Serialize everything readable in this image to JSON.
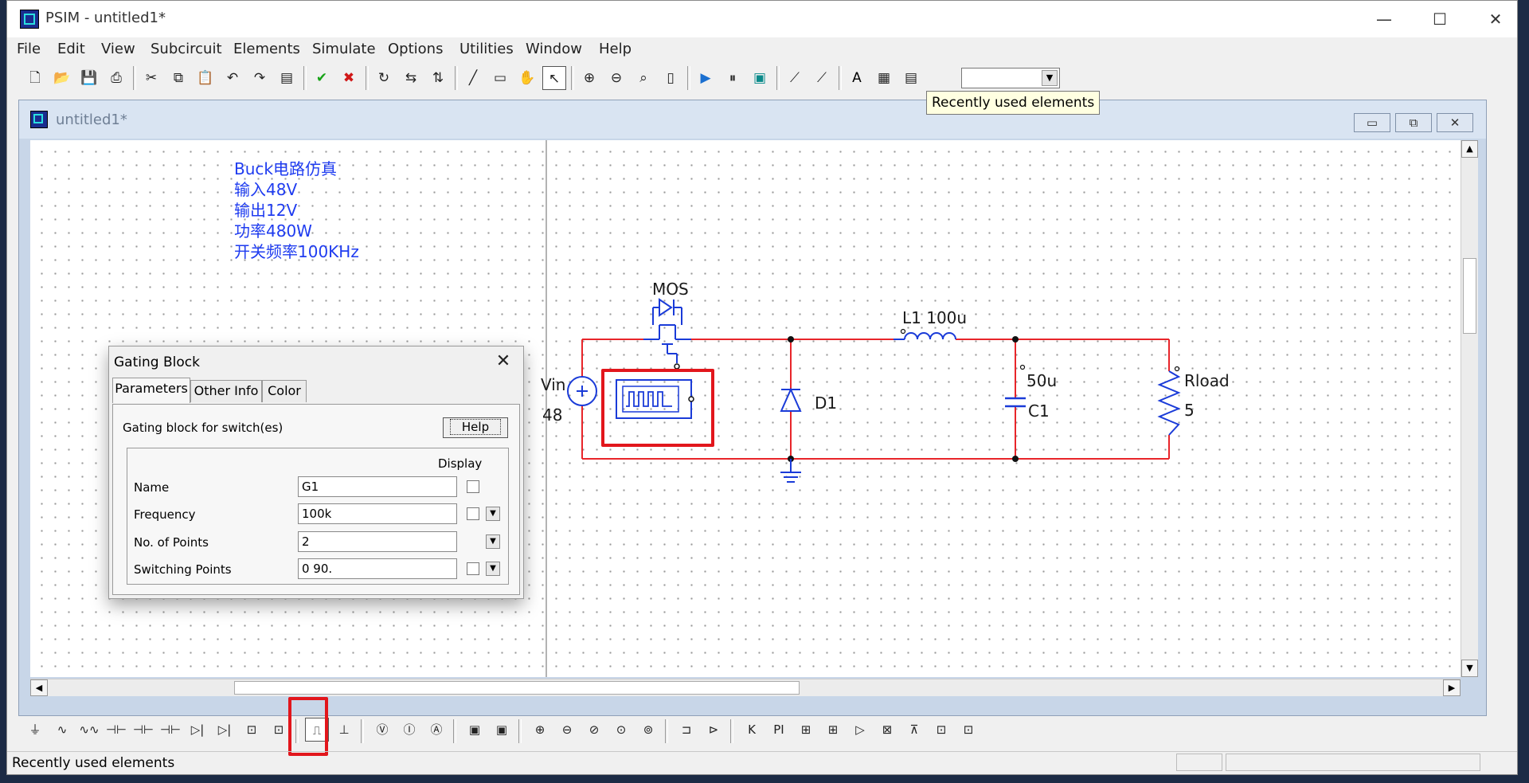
{
  "app": {
    "title": "PSIM - untitled1*",
    "min_glyph": "—",
    "max_glyph": "☐",
    "close_glyph": "✕"
  },
  "menu": [
    "File",
    "Edit",
    "View",
    "Subcircuit",
    "Elements",
    "Simulate",
    "Options",
    "Utilities",
    "Window",
    "Help"
  ],
  "toolbar": {
    "icons": [
      "new-file-icon",
      "open-folder-icon",
      "save-icon",
      "print-icon",
      "cut-icon",
      "copy-icon",
      "paste-icon",
      "undo-icon",
      "redo-icon",
      "clipboard-icon",
      "check-icon",
      "cancel-icon",
      "rotate-icon",
      "flip-lr-icon",
      "flip-tb-icon",
      "wire-icon",
      "label-icon",
      "pan-hand-icon",
      "select-arrow-icon",
      "zoom-in-icon",
      "zoom-out-icon",
      "zoom-fit-icon",
      "fit-page-icon",
      "run-simulation-icon",
      "pause-icon",
      "simview-icon",
      "probe-icon",
      "multi-probe-icon",
      "text-icon",
      "element-list-icon",
      "recent-elements-icon"
    ],
    "combo_value": ""
  },
  "tooltip": "Recently used elements",
  "child_window": {
    "title": "untitled1*",
    "min_glyph": "▭",
    "restore_glyph": "⧉",
    "close_glyph": "✕"
  },
  "note": "Buck电路仿真\n输入48V\n输出12V\n功率480W\n开关频率100KHz",
  "circuit": {
    "mos_label": "MOS",
    "vin_label": "Vin",
    "vin_value": "48",
    "diode_label": "D1",
    "inductor_label": "L1  100u",
    "cap_value": "50u",
    "cap_label": "C1",
    "load_label": "Rload",
    "load_value": "5",
    "colors": {
      "wire": "#e8252a",
      "component": "#1a3bd8",
      "highlight": "#e2161c"
    }
  },
  "dialog": {
    "title": "Gating Block",
    "close_glyph": "✕",
    "tabs": [
      "Parameters",
      "Other Info",
      "Color"
    ],
    "active_tab": "Parameters",
    "description": "Gating block for switch(es)",
    "help_label": "Help",
    "display_header": "Display",
    "params": [
      {
        "label": "Name",
        "value": "G1"
      },
      {
        "label": "Frequency",
        "value": "100k"
      },
      {
        "label": "No. of Points",
        "value": "2"
      },
      {
        "label": "Switching Points",
        "value": "0 90."
      }
    ]
  },
  "element_bar": {
    "icons": [
      "ground-icon",
      "resistor-icon",
      "rl-branch-icon",
      "capacitor-icon",
      "rc-branch-icon",
      "rlc-branch-icon",
      "diode-icon",
      "thyristor-icon",
      "igbt-icon",
      "mosfet-icon",
      "gating-block-icon",
      "on-off-controller-icon",
      "voltage-probe-icon",
      "current-probe-icon",
      "ammeter-icon",
      "voltmeter-scope-icon",
      "current-scope-icon",
      "dc-source-icon",
      "ac-source-icon",
      "square-source-icon",
      "triangle-source-icon",
      "step-source-icon",
      "transformer-icon",
      "switch-controller-icon",
      "integrator-icon",
      "pi-controller-icon",
      "comparator-icon",
      "limiter-icon",
      "summer-icon",
      "multiplier-icon",
      "sampler-icon",
      "zoh-icon",
      "unit-delay-icon"
    ],
    "glyphs": [
      "⏚",
      "∿",
      "∿∿",
      "⊣⊢",
      "⊣⊢",
      "⊣⊢",
      "▷|",
      "▷|",
      "⊡",
      "⊡",
      "⎍",
      "⊥",
      "Ⓥ",
      "Ⓘ",
      "Ⓐ",
      "▣",
      "▣",
      "⊕",
      "⊖",
      "⊘",
      "⊙",
      "⊚",
      "⊐",
      "⊳",
      "K",
      "PI",
      "⊞",
      "⊞",
      "▷",
      "⊠",
      "⊼",
      "⊡",
      "⊡"
    ]
  },
  "status": {
    "text": "Recently used elements"
  }
}
